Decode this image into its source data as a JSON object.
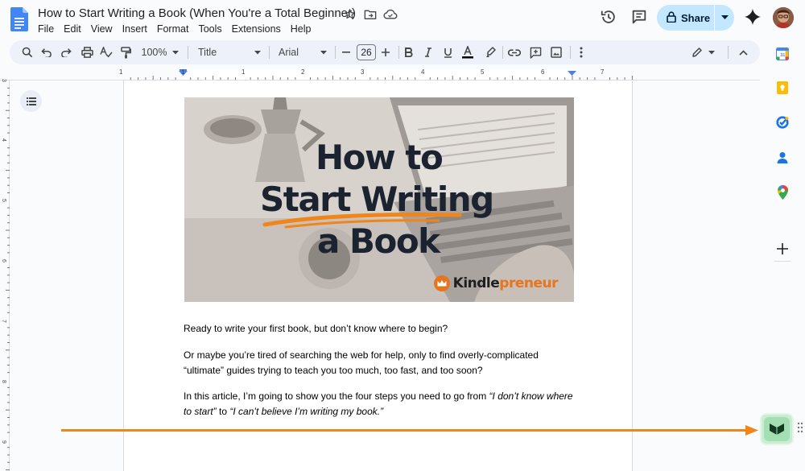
{
  "app": {
    "doc_title": "How to Start Writing a Book (When You're a Total Beginner)"
  },
  "menu": [
    "File",
    "Edit",
    "View",
    "Insert",
    "Format",
    "Tools",
    "Extensions",
    "Help"
  ],
  "header": {
    "share_label": "Share"
  },
  "toolbar": {
    "zoom": "100%",
    "style": "Title",
    "font": "Arial",
    "font_size": "26"
  },
  "ruler": {
    "labels": [
      "1",
      "1",
      "2",
      "3",
      "4",
      "5",
      "6",
      "7"
    ]
  },
  "vruler": {
    "labels": [
      "3",
      "4",
      "5",
      "6",
      "7",
      "8",
      "9"
    ]
  },
  "hero": {
    "line1": "How to",
    "line2": "Start Writing",
    "line3": "a Book",
    "brand_a": "Kindle",
    "brand_b": "preneur"
  },
  "body": {
    "p1": "Ready to write your first book, but don’t know where to begin?",
    "p2": "Or maybe you’re tired of searching the web for help, only to find overly-complicated “ultimate” guides trying to teach you too much, too fast, and too soon?",
    "p3_a": "In this article, I’m going to show you the four steps you need to go from ",
    "p3_b": "“I don’t know where to start”",
    "p3_c": " to ",
    "p3_d": "“I can’t believe I’m writing my book.”"
  },
  "colors": {
    "accent_orange": "#f0861a",
    "share_bg": "#c2e7ff",
    "extension_green": "#a3dfb3"
  },
  "icons": [
    "docs-logo",
    "star-icon",
    "move-icon",
    "cloud-status-icon",
    "history-icon",
    "comment-icon",
    "lock-icon",
    "gemini-icon",
    "search-icon",
    "undo-icon",
    "redo-icon",
    "print-icon",
    "spellcheck-icon",
    "paint-format-icon",
    "bold-icon",
    "italic-icon",
    "underline-icon",
    "text-color-icon",
    "highlight-icon",
    "link-icon",
    "add-comment-icon",
    "image-icon",
    "more-icon",
    "edit-mode-icon",
    "collapse-icon",
    "outline-icon",
    "calendar-icon",
    "keep-icon",
    "tasks-icon",
    "contacts-icon",
    "maps-icon",
    "add-addon-icon",
    "kindlepreneur-extension-icon"
  ]
}
